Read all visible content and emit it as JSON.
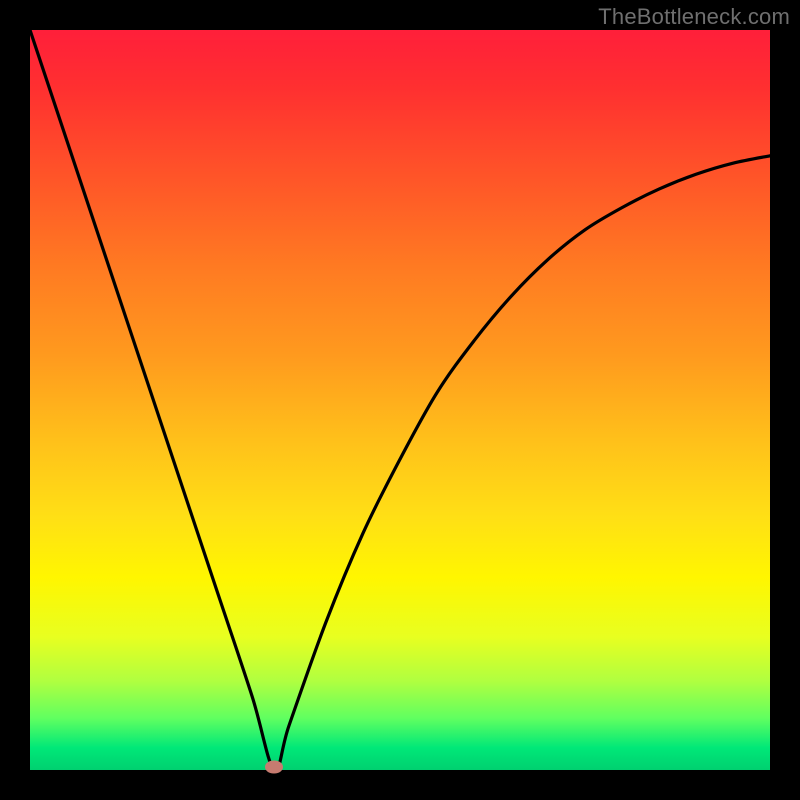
{
  "watermark": "TheBottleneck.com",
  "chart_data": {
    "type": "line",
    "title": "",
    "xlabel": "",
    "ylabel": "",
    "xlim": [
      0,
      100
    ],
    "ylim": [
      0,
      100
    ],
    "grid": false,
    "legend": false,
    "series": [
      {
        "name": "curve",
        "x": [
          0,
          5,
          10,
          15,
          20,
          25,
          30,
          33,
          35,
          40,
          45,
          50,
          55,
          60,
          65,
          70,
          75,
          80,
          85,
          90,
          95,
          100
        ],
        "values": [
          100,
          85,
          70,
          55,
          40,
          25,
          10,
          0,
          6,
          20,
          32,
          42,
          51,
          58,
          64,
          69,
          73,
          76,
          78.5,
          80.5,
          82,
          83
        ]
      }
    ],
    "marker": {
      "x": 33,
      "y": 0,
      "color": "#c77b70"
    },
    "background_gradient": {
      "top": "#ff1f3a",
      "mid": "#fff600",
      "bottom": "#00d070"
    },
    "frame_color": "#000000",
    "curve_color": "#000000"
  }
}
